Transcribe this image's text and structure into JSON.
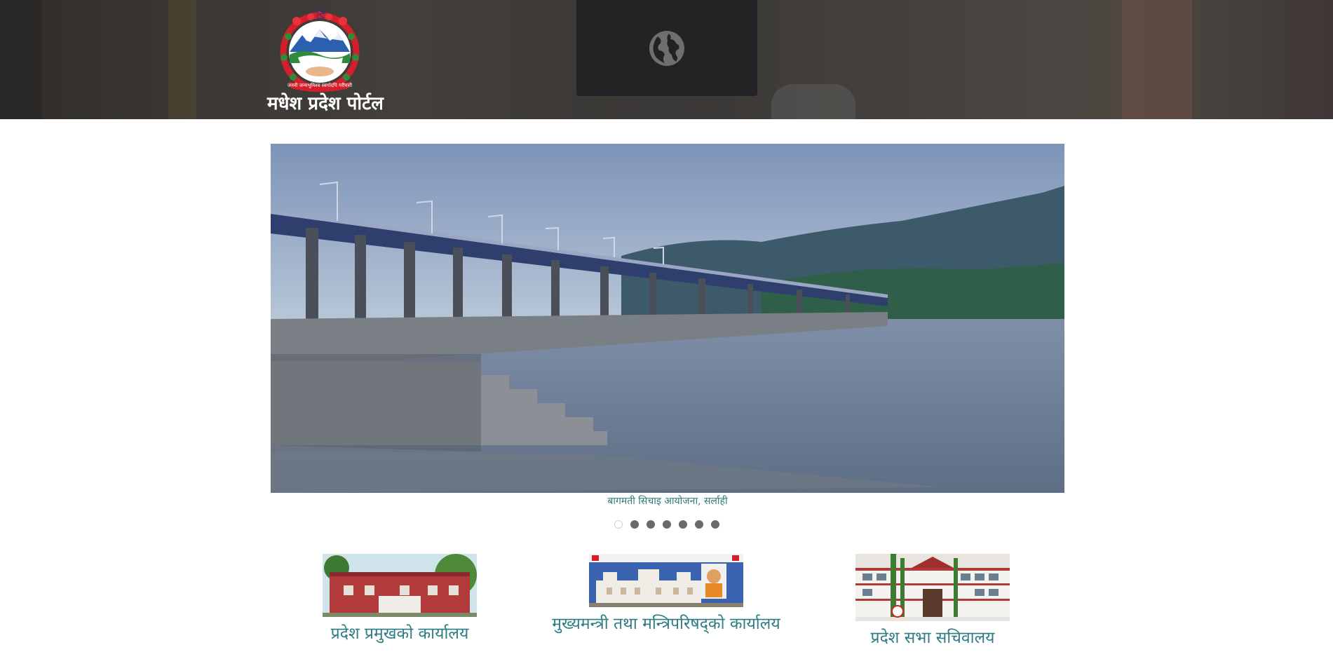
{
  "header": {
    "site_title": "मधेश प्रदेश पोर्टल",
    "emblem_icon": "nepal-emblem-icon",
    "language_icon": "globe-icon"
  },
  "slider": {
    "caption": "बागमती सिचाइ आयोजना, सर्लाही",
    "slide_count": 7,
    "active_index": 0,
    "dots": [
      "1",
      "2",
      "3",
      "4",
      "5",
      "6",
      "7"
    ]
  },
  "cards": [
    {
      "label": "प्रदेश प्रमुखको कार्यालय"
    },
    {
      "label": "मुख्यमन्त्री तथा मन्त्रिपरिषद्को कार्यालय"
    },
    {
      "label": "प्रदेश सभा सचिवालय"
    }
  ],
  "colors": {
    "link_teal": "#2e7d84",
    "header_dark": "#3a3633",
    "lang_box": "#232325"
  }
}
